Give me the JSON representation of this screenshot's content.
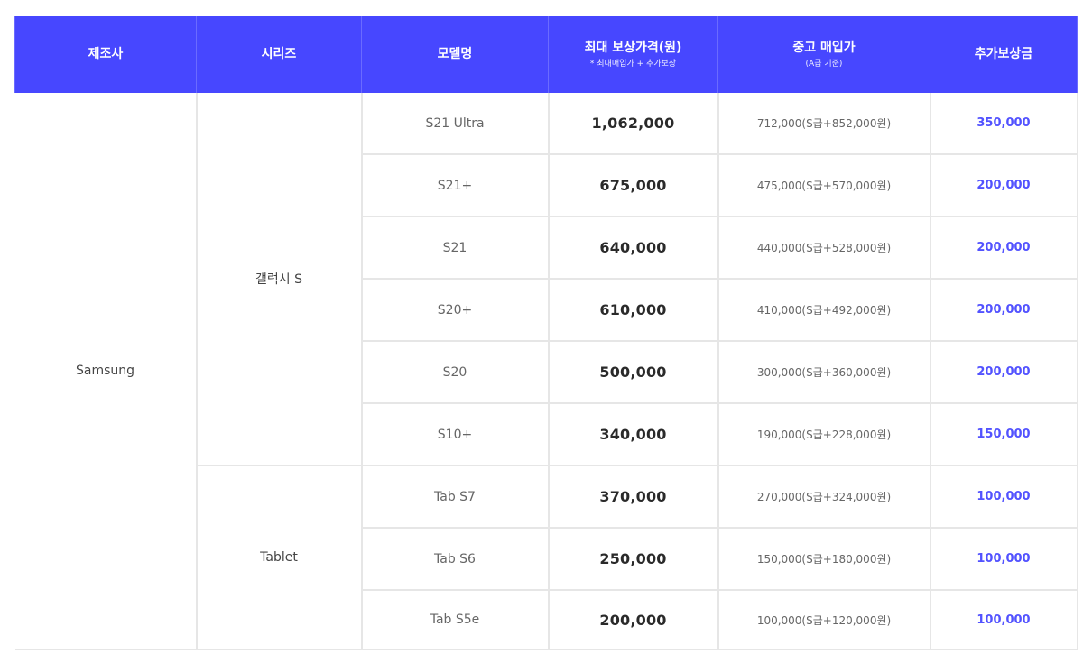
{
  "table": {
    "headers": [
      {
        "label": "제조사",
        "sub": ""
      },
      {
        "label": "시리즈",
        "sub": ""
      },
      {
        "label": "모델명",
        "sub": ""
      },
      {
        "label": "최대 보상가격(원)",
        "sub": "* 최대매입가 + 추가보상"
      },
      {
        "label": "중고 매입가",
        "sub": "(A급 기준)"
      },
      {
        "label": "추가보상금",
        "sub": ""
      }
    ],
    "brand": "Samsung",
    "groups": [
      {
        "series": "갤럭시 S",
        "rows": [
          {
            "model": "S21 Ultra",
            "price": "1,062,000",
            "used": "712,000(S급+852,000원)",
            "extra": "350,000"
          },
          {
            "model": "S21+",
            "price": "675,000",
            "used": "475,000(S급+570,000원)",
            "extra": "200,000"
          },
          {
            "model": "S21",
            "price": "640,000",
            "used": "440,000(S급+528,000원)",
            "extra": "200,000"
          },
          {
            "model": "S20+",
            "price": "610,000",
            "used": "410,000(S급+492,000원)",
            "extra": "200,000"
          },
          {
            "model": "S20",
            "price": "500,000",
            "used": "300,000(S급+360,000원)",
            "extra": "200,000"
          },
          {
            "model": "S10+",
            "price": "340,000",
            "used": "190,000(S급+228,000원)",
            "extra": "150,000"
          }
        ]
      },
      {
        "series": "Tablet",
        "rows": [
          {
            "model": "Tab S7",
            "price": "370,000",
            "used": "270,000(S급+324,000원)",
            "extra": "100,000"
          },
          {
            "model": "Tab S6",
            "price": "250,000",
            "used": "150,000(S급+180,000원)",
            "extra": "100,000"
          },
          {
            "model": "Tab S5e",
            "price": "200,000",
            "used": "100,000(S급+120,000원)",
            "extra": "100,000"
          }
        ]
      }
    ]
  },
  "colors": {
    "header_bg": "#4747ff",
    "header_text": "#ffffff",
    "accent_text": "#5252ff",
    "grid": "#e6e6e6"
  }
}
